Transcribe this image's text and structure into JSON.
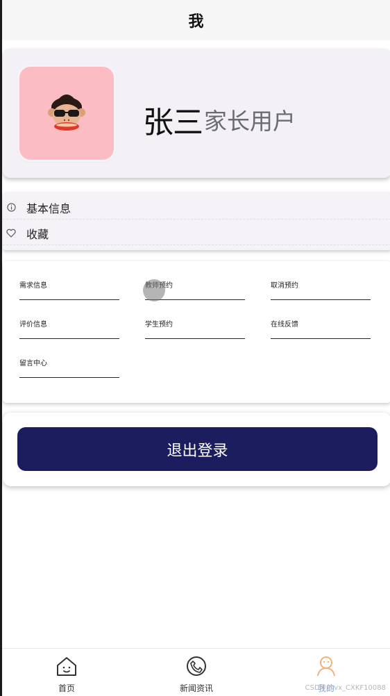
{
  "header": {
    "title": "我"
  },
  "profile": {
    "name": "张三",
    "role": "家长用户",
    "avatar_icon": "monkey-avatar-icon"
  },
  "info_menu": [
    {
      "label": "基本信息",
      "icon": "info-circle-icon"
    },
    {
      "label": "收藏",
      "icon": "heart-icon"
    }
  ],
  "grid_menu": [
    {
      "label": "需求信息"
    },
    {
      "label": "教师预约"
    },
    {
      "label": "取消预约"
    },
    {
      "label": "评价信息"
    },
    {
      "label": "学生预约"
    },
    {
      "label": "在线反馈"
    },
    {
      "label": "留言中心"
    }
  ],
  "logout": {
    "label": "退出登录"
  },
  "bottom_nav": [
    {
      "label": "首页",
      "icon": "home-icon"
    },
    {
      "label": "新闻资讯",
      "icon": "phone-icon"
    },
    {
      "label": "我的",
      "icon": "user-icon",
      "active": true
    }
  ],
  "watermark": "CSDN @vx_CXKF10088",
  "colors": {
    "accent": "#1c1d5e",
    "avatar_bg": "#fcbcc3",
    "active_tab": "#f0b27a",
    "active_label": "#7ea6e0"
  }
}
